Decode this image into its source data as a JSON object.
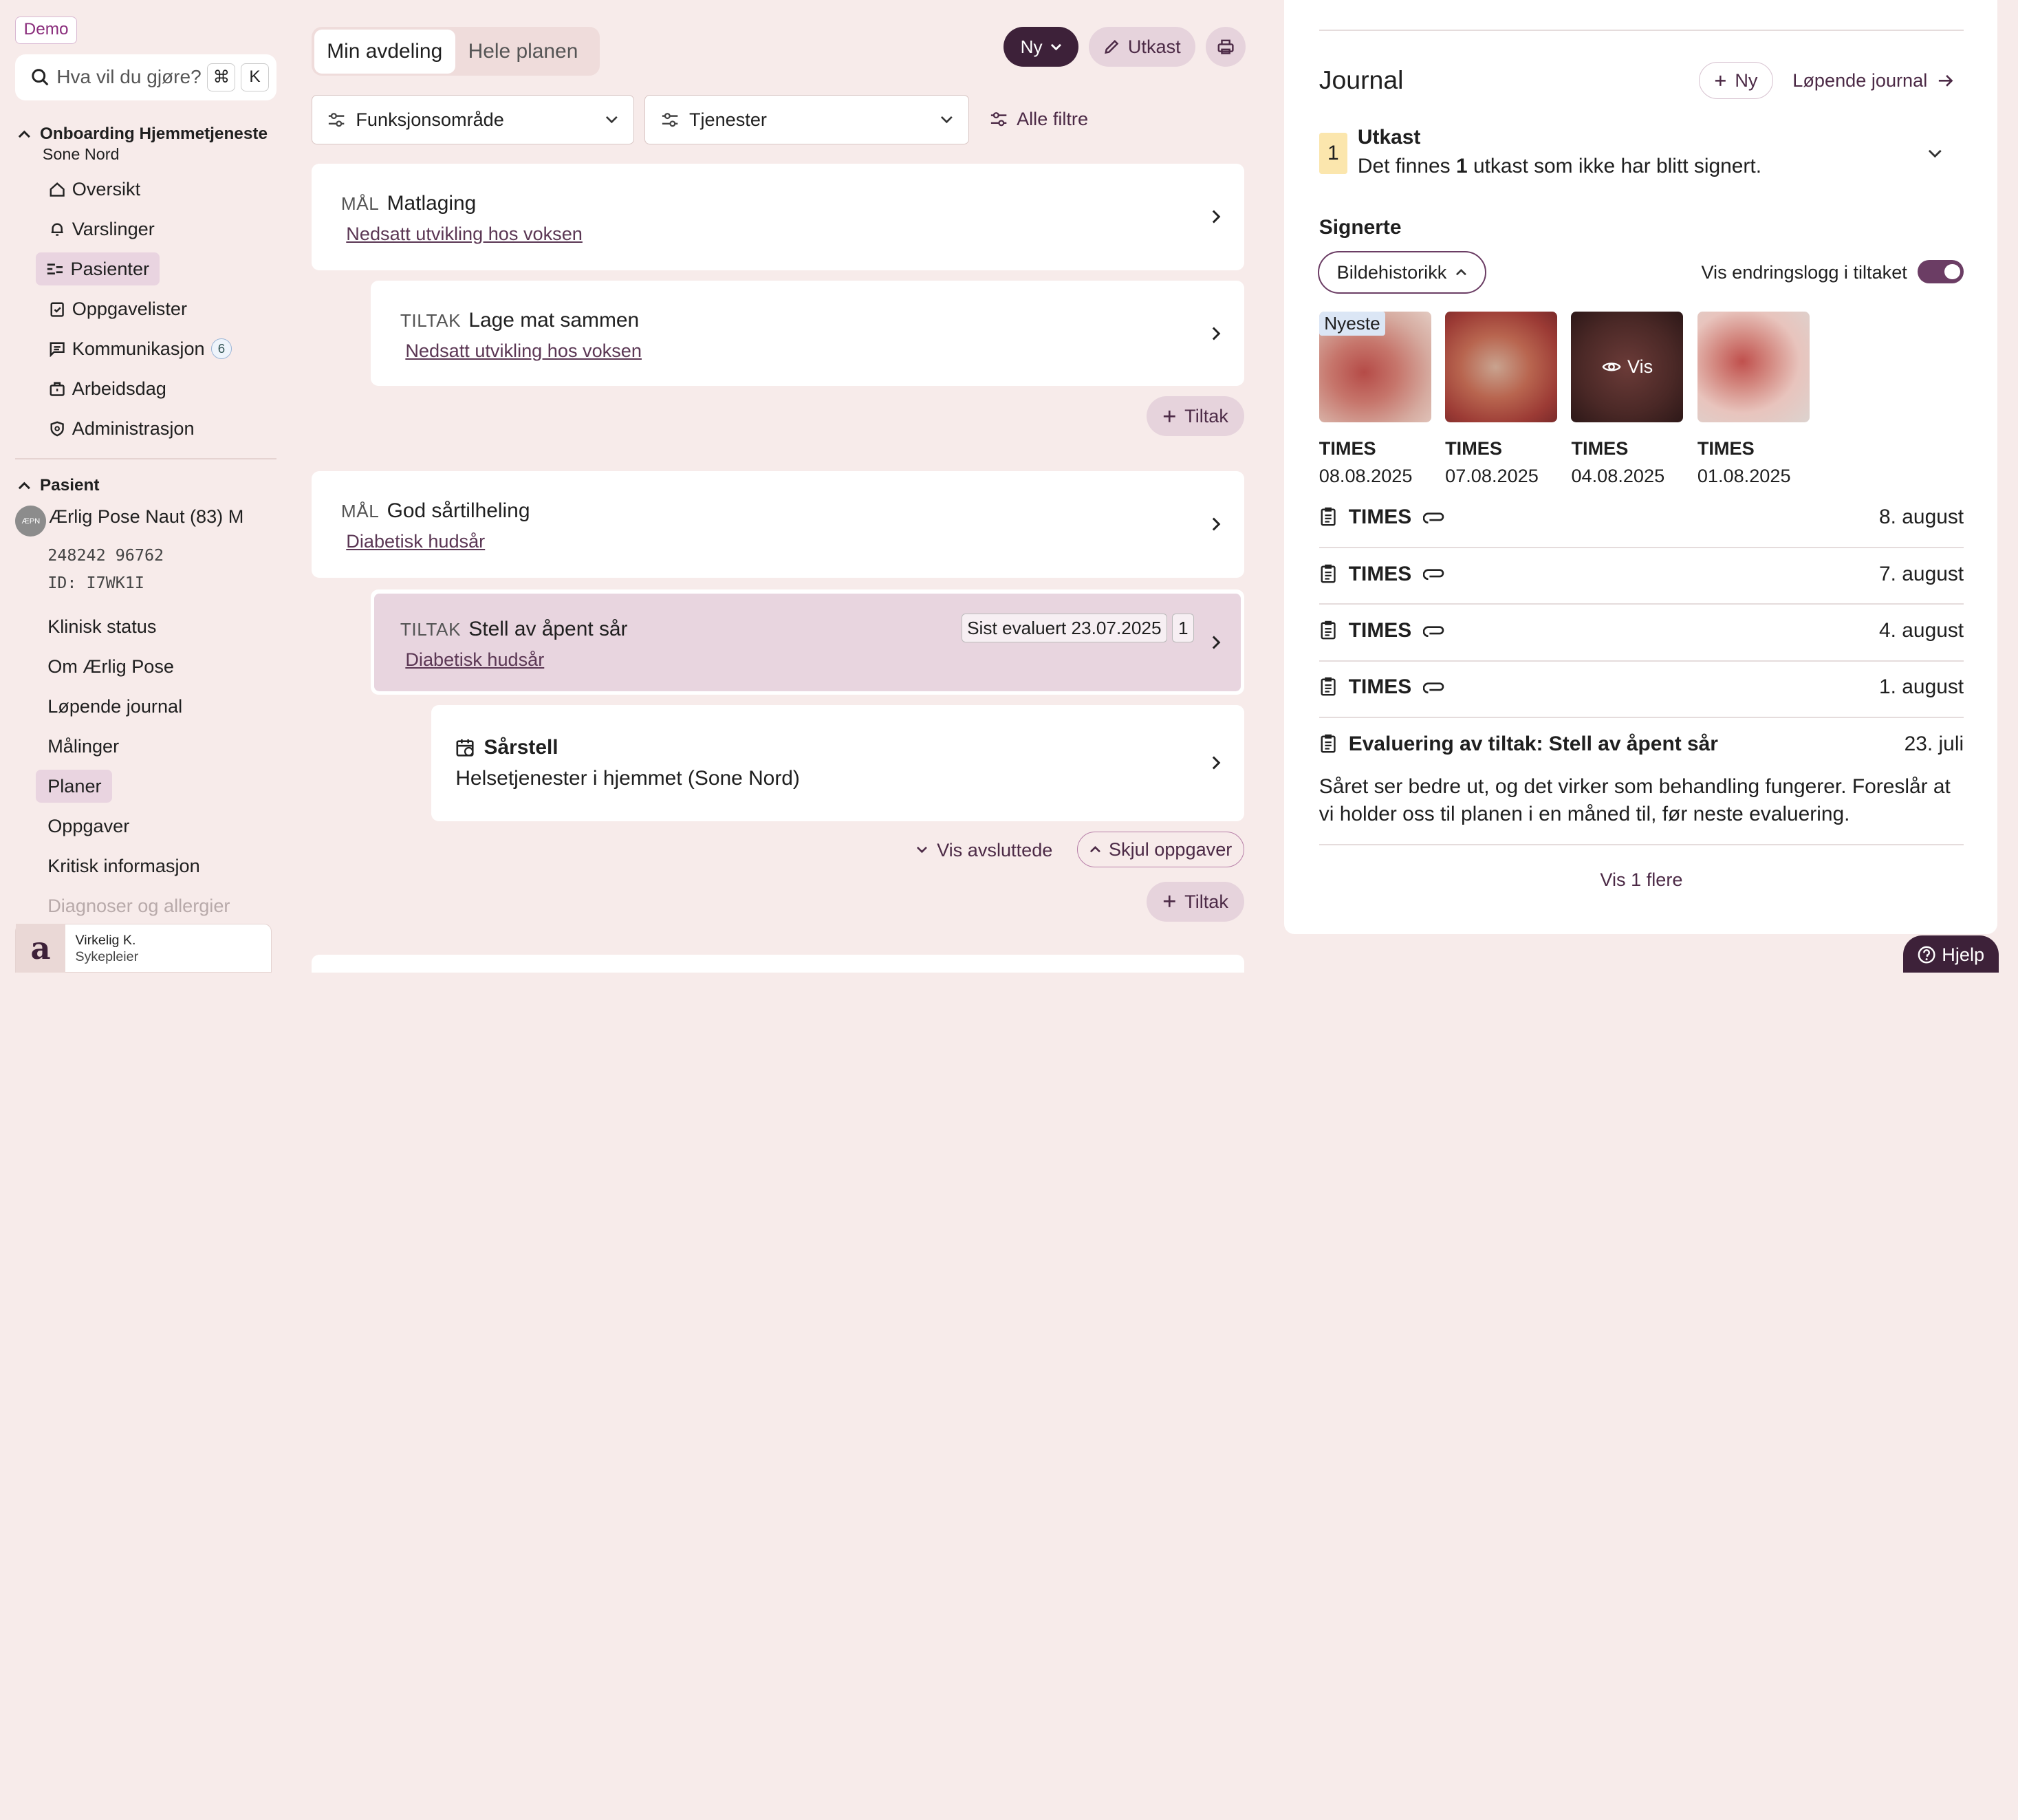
{
  "sidebar": {
    "demo_badge": "Demo",
    "search_placeholder": "Hva vil du gjøre?",
    "shortcut_keys": [
      "⌘",
      "K"
    ],
    "org_name": "Onboarding Hjemmetjeneste",
    "org_sub": "Sone Nord",
    "nav": [
      {
        "label": "Oversikt",
        "icon": "home-icon"
      },
      {
        "label": "Varslinger",
        "icon": "bell-icon"
      },
      {
        "label": "Pasienter",
        "icon": "patients-icon",
        "selected": true
      },
      {
        "label": "Oppgavelister",
        "icon": "clipboard-icon"
      },
      {
        "label": "Kommunikasjon",
        "icon": "chat-icon",
        "badge": "6"
      },
      {
        "label": "Arbeidsdag",
        "icon": "briefcase-icon"
      },
      {
        "label": "Administrasjon",
        "icon": "shield-icon"
      }
    ],
    "patient_section": "Pasient",
    "patient": {
      "avatar": "ÆPN",
      "name": "Ærlig Pose Naut (83) M",
      "ssn": "248242 96762",
      "id": "ID: I7WK1I"
    },
    "patient_nav": [
      "Klinisk status",
      "Om Ærlig Pose",
      "Løpende journal",
      "Målinger",
      "Planer",
      "Oppgaver",
      "Kritisk informasjon",
      "Diagnoser og allergier"
    ],
    "patient_nav_selected": "Planer",
    "user": {
      "logo": "a",
      "name": "Virkelig K.",
      "role": "Sykepleier"
    }
  },
  "main": {
    "tabs": [
      "Min avdeling",
      "Hele planen"
    ],
    "actions": {
      "new": "Ny",
      "draft": "Utkast"
    },
    "filters": {
      "functional": "Funksjonsområde",
      "services": "Tjenester",
      "all": "Alle filtre"
    },
    "goal1": {
      "label": "MÅL",
      "title": "Matlaging",
      "link": "Nedsatt utvikling hos voksen"
    },
    "measure1": {
      "label": "TILTAK",
      "title": "Lage mat sammen",
      "link": "Nedsatt utvikling hos voksen"
    },
    "add_measure": "Tiltak",
    "goal2": {
      "label": "MÅL",
      "title": "God sårtilheling",
      "link": "Diabetisk hudsår"
    },
    "measure2": {
      "label": "TILTAK",
      "title": "Stell av åpent sår",
      "link": "Diabetisk hudsår",
      "evaluated": "Sist evaluert 23.07.2025",
      "count": "1"
    },
    "task": {
      "title": "Sårstell",
      "service": "Helsetjenester i hjemmet (Sone Nord)"
    },
    "show_closed": "Vis avsluttede",
    "hide_tasks": "Skjul oppgaver"
  },
  "journal": {
    "title": "Journal",
    "new_btn": "Ny",
    "running_link": "Løpende journal",
    "draft_count": "1",
    "draft_title": "Utkast",
    "draft_pre": "Det finnes",
    "draft_num": "1",
    "draft_post": "utkast som ikke har blitt signert.",
    "signed_title": "Signerte",
    "image_history": "Bildehistorikk",
    "changelog_toggle": "Vis endringslogg i tiltaket",
    "newest_badge": "Nyeste",
    "view_label": "Vis",
    "images": [
      {
        "title": "TIMES",
        "date": "08.08.2025"
      },
      {
        "title": "TIMES",
        "date": "07.08.2025"
      },
      {
        "title": "TIMES",
        "date": "04.08.2025"
      },
      {
        "title": "TIMES",
        "date": "01.08.2025"
      }
    ],
    "entries": [
      {
        "title": "TIMES",
        "date": "8. august"
      },
      {
        "title": "TIMES",
        "date": "7. august"
      },
      {
        "title": "TIMES",
        "date": "4. august"
      },
      {
        "title": "TIMES",
        "date": "1. august"
      }
    ],
    "evaluation": {
      "title": "Evaluering av tiltak: Stell av åpent sår",
      "date": "23. juli",
      "text": "Såret ser bedre ut, og det virker som behandling fungerer. Foreslår at vi holder oss til planen i en måned til, før neste evaluering."
    },
    "show_more": "Vis 1 flere"
  },
  "help": "Hjelp"
}
